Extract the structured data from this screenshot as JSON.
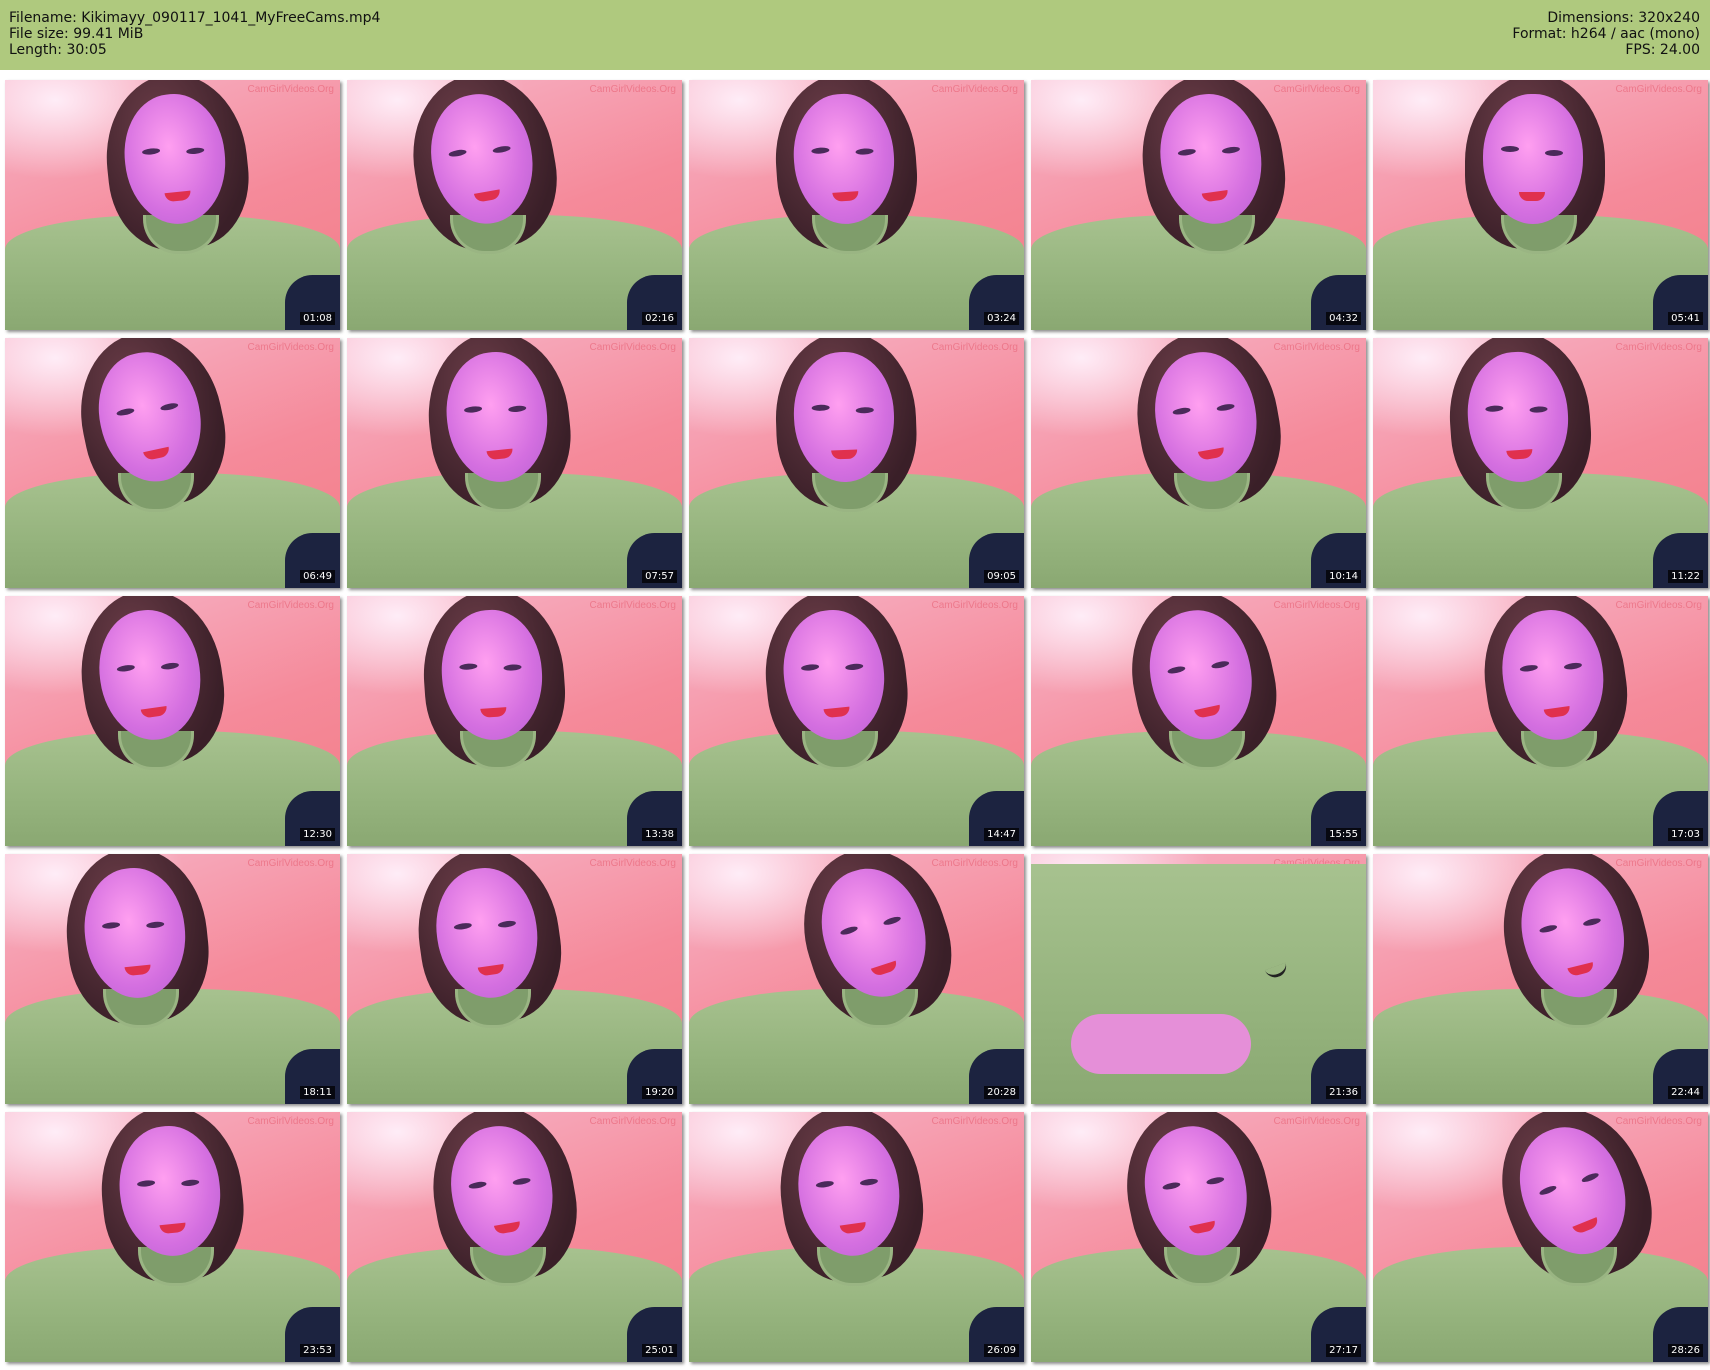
{
  "header": {
    "filename_line": "Filename: Kikimayy_090117_1041_MyFreeCams.mp4",
    "filesize_line": "File size: 99.41 MiB",
    "length_line": "Length: 30:05",
    "dimensions_line": "Dimensions: 320x240",
    "format_line": "Format: h264 / aac (mono)",
    "fps_line": "FPS: 24.00"
  },
  "colors": {
    "header_bg": "#afc97e",
    "shirt": "#9fbc86",
    "background_wall": "#f58a9a"
  },
  "watermark": "CamGirlVideos.Org",
  "thumbnails": [
    {
      "timestamp": "01:08"
    },
    {
      "timestamp": "02:16"
    },
    {
      "timestamp": "03:24"
    },
    {
      "timestamp": "04:32"
    },
    {
      "timestamp": "05:41"
    },
    {
      "timestamp": "06:49"
    },
    {
      "timestamp": "07:57"
    },
    {
      "timestamp": "09:05"
    },
    {
      "timestamp": "10:14"
    },
    {
      "timestamp": "11:22"
    },
    {
      "timestamp": "12:30"
    },
    {
      "timestamp": "13:38"
    },
    {
      "timestamp": "14:47"
    },
    {
      "timestamp": "15:55"
    },
    {
      "timestamp": "17:03"
    },
    {
      "timestamp": "18:11"
    },
    {
      "timestamp": "19:20"
    },
    {
      "timestamp": "20:28"
    },
    {
      "timestamp": "21:36"
    },
    {
      "timestamp": "22:44"
    },
    {
      "timestamp": "23:53"
    },
    {
      "timestamp": "25:01"
    },
    {
      "timestamp": "26:09"
    },
    {
      "timestamp": "27:17"
    },
    {
      "timestamp": "28:26"
    }
  ]
}
